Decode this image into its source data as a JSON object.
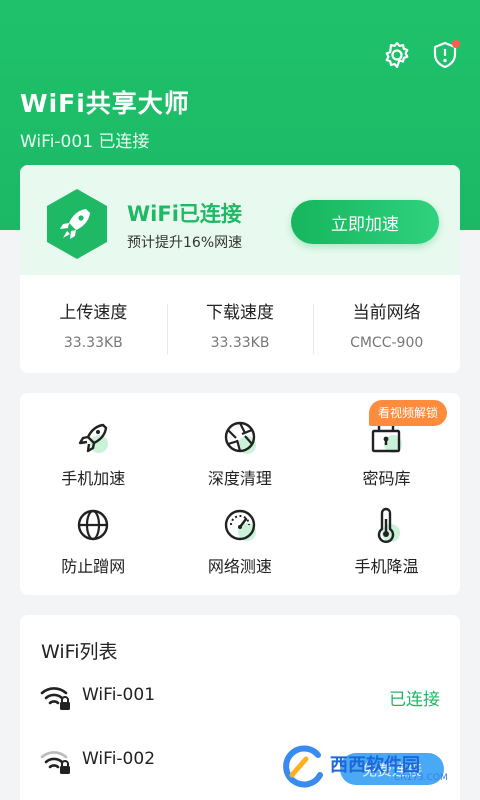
{
  "header": {
    "title": "WiFi共享大师",
    "connection": "WiFi-001 已连接",
    "icons": [
      "gear-icon",
      "shield-alert-icon"
    ]
  },
  "status_card": {
    "title": "WiFi已连接",
    "subtitle": "预计提升16%网速",
    "boost_button": "立即加速",
    "stats": [
      {
        "label": "上传速度",
        "value": "33.33KB"
      },
      {
        "label": "下载速度",
        "value": "33.33KB"
      },
      {
        "label": "当前网络",
        "value": "CMCC-900"
      }
    ]
  },
  "tools": {
    "items": [
      {
        "label": "手机加速",
        "icon": "rocket-icon"
      },
      {
        "label": "深度清理",
        "icon": "aperture-icon"
      },
      {
        "label": "密码库",
        "icon": "lock-box-icon"
      },
      {
        "label": "防止蹭网",
        "icon": "globe-icon"
      },
      {
        "label": "网络测速",
        "icon": "speedometer-icon"
      },
      {
        "label": "手机降温",
        "icon": "thermometer-icon"
      }
    ],
    "badge": "看视频解锁"
  },
  "wifi_list": {
    "title": "WiFi列表",
    "items": [
      {
        "name": "WiFi-001",
        "state": "已连接"
      },
      {
        "name": "WiFi-002",
        "action": "免费连接"
      }
    ]
  },
  "watermark": {
    "text": "西西软件园",
    "sub": "CR173.COM"
  },
  "colors": {
    "accent": "#1fc26b",
    "badge": "#ff8b3d",
    "blue": "#4aa9f5"
  }
}
